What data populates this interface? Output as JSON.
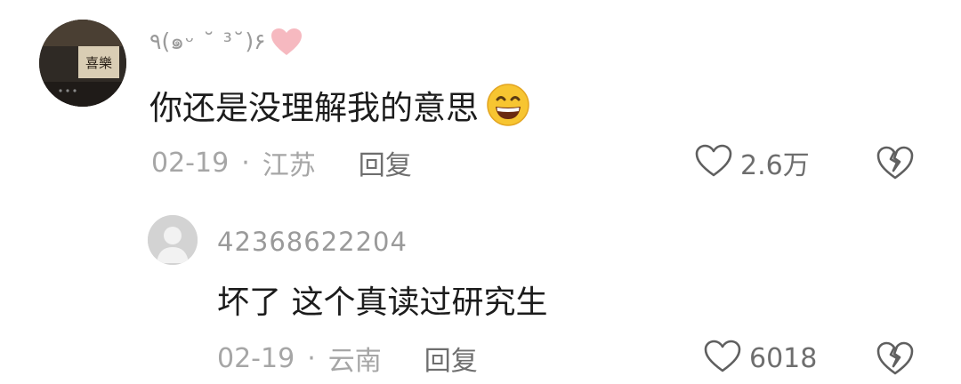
{
  "comment": {
    "username": "٩(๑ᵕ ˘ ³˘)۶",
    "username_icon": "pink-heart-icon",
    "avatar_text": "喜樂",
    "text": "你还是没理解我的意思",
    "emoji": "grinning-face-icon",
    "date": "02-19",
    "separator": "·",
    "location": "江苏",
    "reply_label": "回复",
    "like_count": "2.6万",
    "like_icon": "heart-outline-icon",
    "dislike_icon": "broken-heart-icon"
  },
  "reply": {
    "username": "42368622204",
    "avatar_icon": "default-user-avatar-icon",
    "text": "坏了 这个真读过研究生",
    "date": "02-19",
    "separator": "·",
    "location": "云南",
    "reply_label": "回复",
    "like_count": "6018",
    "like_icon": "heart-outline-icon",
    "dislike_icon": "broken-heart-icon"
  },
  "colors": {
    "text_primary": "#1c1c1c",
    "text_secondary": "#9a9a9a",
    "heart_pink": "#f4b6bd"
  }
}
